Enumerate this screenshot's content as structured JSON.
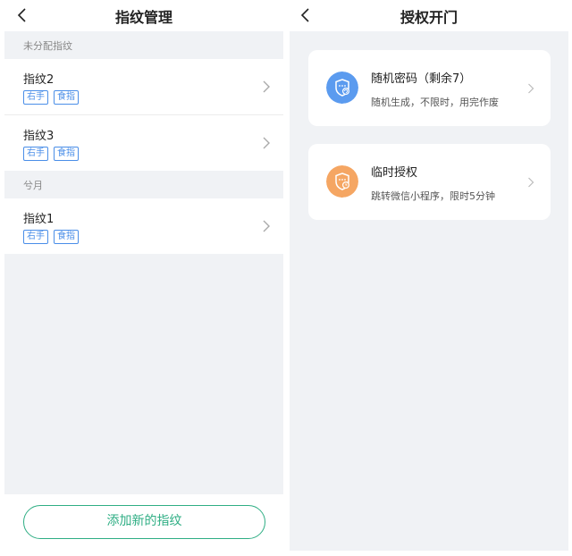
{
  "left_screen": {
    "title": "指纹管理",
    "sections": [
      {
        "header": "未分配指纹",
        "items": [
          {
            "name": "指纹2",
            "tags": [
              "右手",
              "食指"
            ]
          },
          {
            "name": "指纹3",
            "tags": [
              "右手",
              "食指"
            ]
          }
        ]
      },
      {
        "header": "兮月",
        "items": [
          {
            "name": "指纹1",
            "tags": [
              "右手",
              "食指"
            ]
          }
        ]
      }
    ],
    "add_button_label": "添加新的指纹"
  },
  "right_screen": {
    "title": "授权开门",
    "cards": [
      {
        "title": "随机密码（剩余7）",
        "subtitle": "随机生成，不限时，用完作废",
        "icon": "shield-key-icon",
        "icon_color": "#5b9bef"
      },
      {
        "title": "临时授权",
        "subtitle": "跳转微信小程序，限时5分钟",
        "icon": "shield-clock-icon",
        "icon_color": "#f5a663"
      }
    ]
  },
  "colors": {
    "accent_green": "#2fae84",
    "tag_blue": "#4a8ee8",
    "background_gray": "#f0f2f5"
  }
}
